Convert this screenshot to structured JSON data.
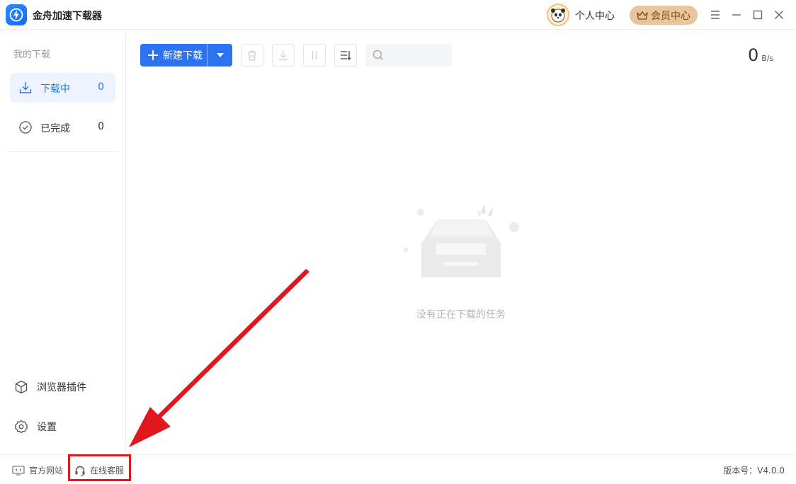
{
  "app": {
    "title": "金舟加速下载器"
  },
  "header": {
    "personal_center": "个人中心",
    "vip_center": "会员中心"
  },
  "sidebar": {
    "section_title": "我的下载",
    "items": [
      {
        "label": "下载中",
        "count": "0",
        "icon": "download-icon",
        "active": true
      },
      {
        "label": "已完成",
        "count": "0",
        "icon": "check-circle-icon",
        "active": false
      }
    ],
    "bottom_items": [
      {
        "label": "浏览器插件",
        "icon": "browser-plugin-icon"
      },
      {
        "label": "设置",
        "icon": "gear-icon"
      }
    ]
  },
  "toolbar": {
    "new_download": "新建下载",
    "search_placeholder": ""
  },
  "speed": {
    "value": "0",
    "unit": "B/s"
  },
  "empty_state": {
    "message": "没有正在下载的任务"
  },
  "footer": {
    "official_site": "官方网站",
    "online_support": "在线客服",
    "version": "版本号：V4.0.0"
  },
  "colors": {
    "accent": "#2b73f0",
    "vip": "#e8c59a",
    "highlight": "#e0171d"
  }
}
